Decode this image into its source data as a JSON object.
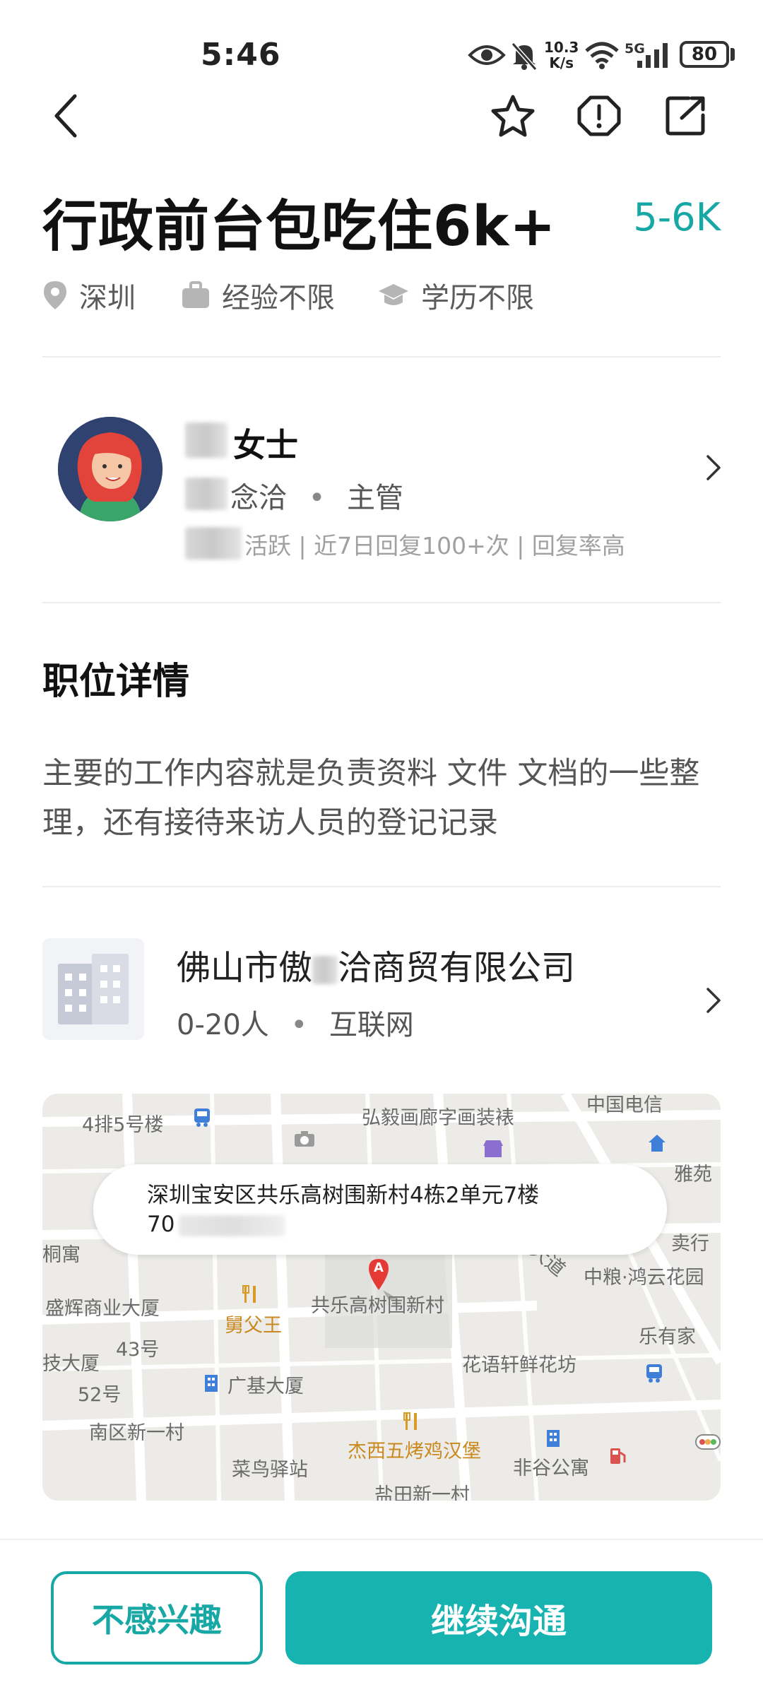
{
  "status_bar": {
    "time": "5:46",
    "net_speed_value": "10.3",
    "net_speed_unit": "K/s",
    "signal_label": "5G",
    "battery": "80",
    "icons": [
      "eye-icon",
      "bell-muted-icon",
      "wifi-icon",
      "cell-signal-icon",
      "battery-icon"
    ]
  },
  "nav": {
    "icons": [
      "back-icon",
      "star-icon",
      "report-icon",
      "share-icon"
    ]
  },
  "job": {
    "title": "行政前台包吃住6k+",
    "salary": "5-6K",
    "location": "深圳",
    "experience": "经验不限",
    "education": "学历不限"
  },
  "recruiter": {
    "name_visible": "女士",
    "company_visible": "念洽",
    "separator": "•",
    "role": "主管",
    "activity": "活跃 | 近7日回复100+次 | 回复率高"
  },
  "details": {
    "section_title": "职位详情",
    "description": "主要的工作内容就是负责资料 文件 文档的一些整理，还有接待来访人员的登记记录"
  },
  "company": {
    "name_part1": "佛山市傲",
    "name_part2": "洽商贸有限公司",
    "size": "0-20人",
    "separator": "•",
    "industry": "互联网"
  },
  "map": {
    "address_line1": "深圳宝安区共乐高树围新村4栋2单元7楼",
    "address_line2": "70",
    "marker_letter": "A",
    "labels": {
      "l1": "4排5号楼",
      "l2": "弘毅画廊字画装裱",
      "l3": "中国电信",
      "l4": "雅苑",
      "l5": "桐寓",
      "l6": "卖行",
      "l7": "大道",
      "l8": "中粮·鸿云花园",
      "l9": "盛辉商业大厦",
      "l10": "舅父王",
      "l11": "共乐高树围新村",
      "l12": "乐有家",
      "l13": "技大厦",
      "l14": "43号",
      "l15": "花语轩鲜花坊",
      "l16": "52号",
      "l17": "广基大厦",
      "l18": "南区新一村",
      "l19": "杰西五烤鸡汉堡",
      "l20": "菜鸟驿站",
      "l21": "非谷公寓",
      "l22": "盐田新一村"
    }
  },
  "actions": {
    "not_interested": "不感兴趣",
    "continue_chat": "继续沟通"
  },
  "colors": {
    "accent": "#17a7a5",
    "button_fill": "#17b3b0"
  }
}
